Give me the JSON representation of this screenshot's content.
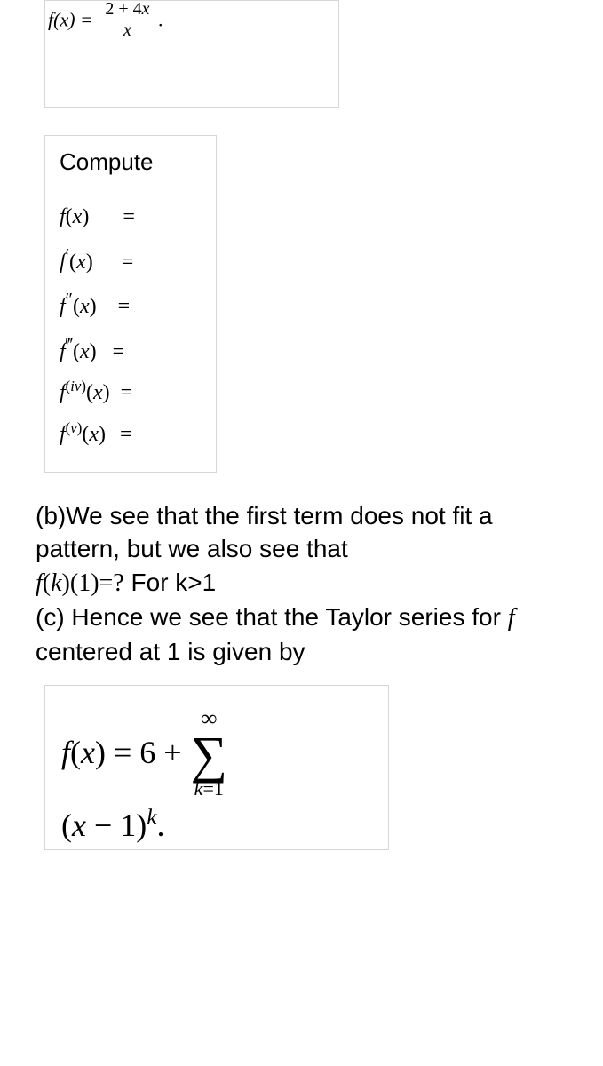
{
  "box1": {
    "lhs": "f(x) =",
    "frac_num": "2 + 4x",
    "frac_den": "x",
    "tail": "."
  },
  "box2": {
    "title": "Compute",
    "rows": [
      {
        "lhs": "f(x)",
        "eq": "="
      },
      {
        "lhs": "f′(x)",
        "eq": "="
      },
      {
        "lhs": "f″(x)",
        "eq": "="
      },
      {
        "lhs": "f‴(x)",
        "eq": "="
      },
      {
        "lhs": "f(iv)(x)",
        "eq": "="
      },
      {
        "lhs": "f(v)(x)",
        "eq": "="
      }
    ]
  },
  "body": {
    "line1": "(b)We see that the first term does not fit a pattern, but we also see that",
    "line2_prefix": "f(k)(1)=?",
    "line2_suffix": " For k>1",
    "line3": "(c) Hence we see that the Taylor series for",
    "line3_f": "f",
    "line3_mid": " centered at 1 is given by"
  },
  "box3": {
    "lhs": "f(x) = 6 +",
    "sigma_top": "∞",
    "sigma_bot_k": "k",
    "sigma_bot_eq": "=1",
    "line2_open": "(",
    "line2_x": "x",
    "line2_minus": " − 1)",
    "line2_sup": "k",
    "line2_dot": "."
  }
}
